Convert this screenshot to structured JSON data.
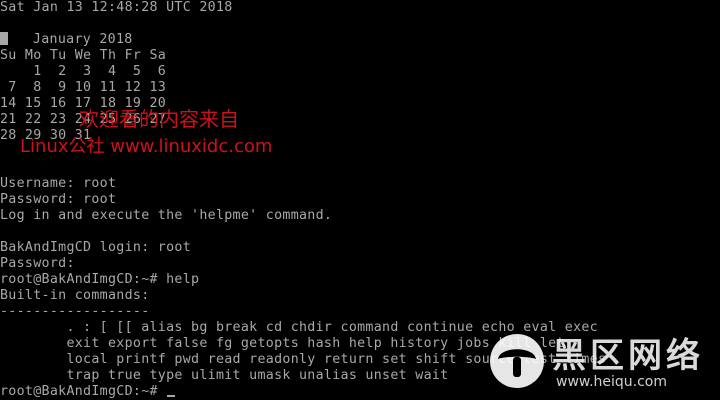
{
  "terminal": {
    "datetime": "Sat Jan 13 12:48:28 UTC 2018",
    "calendar": {
      "month_header": "   January 2018",
      "weekdays": "Su Mo Tu We Th Fr Sa",
      "weeks": [
        "    1  2  3  4  5  6",
        " 7  8  9 10 11 12 13",
        "14 15 16 17 18 19 20",
        "21 22 23 24 25 26 27",
        "28 29 30 31"
      ]
    },
    "credentials": {
      "username_line": "Username: root",
      "password_line": "Password: root",
      "instruction": "Log in and execute the 'helpme' command."
    },
    "login": {
      "login_line": "BakAndImgCD login: root",
      "password_prompt": "Password:"
    },
    "session": {
      "prompt": "root@BakAndImgCD:~# ",
      "command": "help",
      "builtin_header": "Built-in commands:",
      "separator": "------------------",
      "builtins": [
        "        . : [ [[ alias bg break cd chdir command continue echo eval exec",
        "        exit export false fg getopts hash help history jobs kill let",
        "        local printf pwd read readonly return set shift source test times",
        "        trap true type ulimit umask unalias unset wait"
      ],
      "final_prompt": "root@BakAndImgCD:~# "
    }
  },
  "watermarks": {
    "line1": "欢迎看的内容来自",
    "line2": "Linux公社 www.linuxidc.com",
    "badge_title": "黑区网络",
    "badge_url": "www.heiqu.com",
    "red_color": "#e0141c"
  }
}
